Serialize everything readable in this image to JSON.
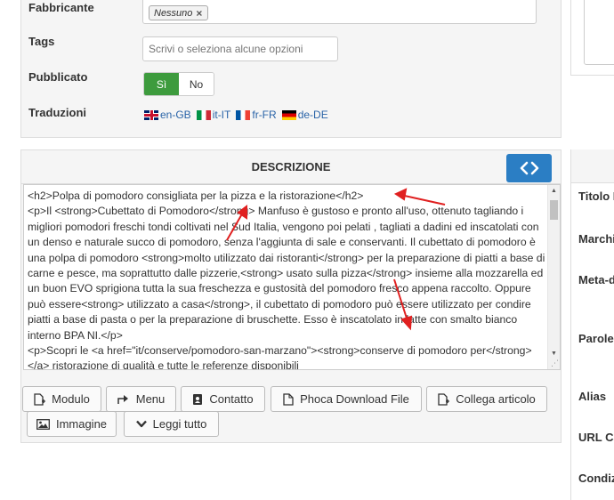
{
  "form": {
    "fabbricante_label": "Fabbricante",
    "fabbricante_chip": "Nessuno",
    "tags_label": "Tags",
    "tags_placeholder": "Scrivi o seleziona alcune opzioni",
    "pubblicato_label": "Pubblicato",
    "pubblicato_yes": "Sì",
    "pubblicato_no": "No",
    "traduzioni_label": "Traduzioni",
    "languages": [
      "en-GB",
      "it-IT",
      "fr-FR",
      "de-DE"
    ]
  },
  "descrizione": {
    "header": "DESCRIZIONE",
    "code_toggle_icon": "code-icon",
    "content": "<h2>Polpa di pomodoro consigliata per la pizza e la ristorazione</h2>\n<p>Il <strong>Cubettato di Pomodoro</strong> Manfuso è gustoso e pronto all'uso, ottenuto tagliando i migliori pomodori freschi tondi coltivati nel Sud Italia, vengono poi pelati , tagliati a dadini ed inscatolati con un denso e naturale succo di pomodoro, senza l'aggiunta di sale e conservanti. Il cubettato di pomodoro è una polpa di pomodoro <strong>molto utilizzato dai ristoranti</strong> per la preparazione di piatti a base di carne e pesce, ma soprattutto dalle pizzerie,<strong> usato sulla pizza</strong> insieme alla mozzarella ed un buon EVO sprigiona tutta la sua freschezza e gustosità del pomodoro fresco appena raccolto. Oppure può essere<strong> utilizzato a casa</strong>, il cubettato di pomodoro può essere utilizzato per condire piatti a base di pasta o per la preparazione di bruschette. Esso è inscatolato in latte con smalto bianco interno BPA NI.</p>\n<p>Scopri le <a href=\"it/conserve/pomodoro-san-marzano\"><strong>conserve di pomodoro per</strong></a> ristorazione di qualità e tutte le referenze disponibili"
  },
  "buttons": {
    "modulo": "Modulo",
    "menu": "Menu",
    "contatto": "Contatto",
    "phoca": "Phoca Download File",
    "collega": "Collega articolo",
    "immagine": "Immagine",
    "leggi": "Leggi tutto"
  },
  "right_panel": {
    "titolo": "Titolo I",
    "marchi": "Marchi",
    "meta": "Meta-d",
    "parole": "Parole",
    "alias": "Alias",
    "url": "URL Ca",
    "condiz": "Condiz"
  },
  "annotation_color": "#e02020"
}
